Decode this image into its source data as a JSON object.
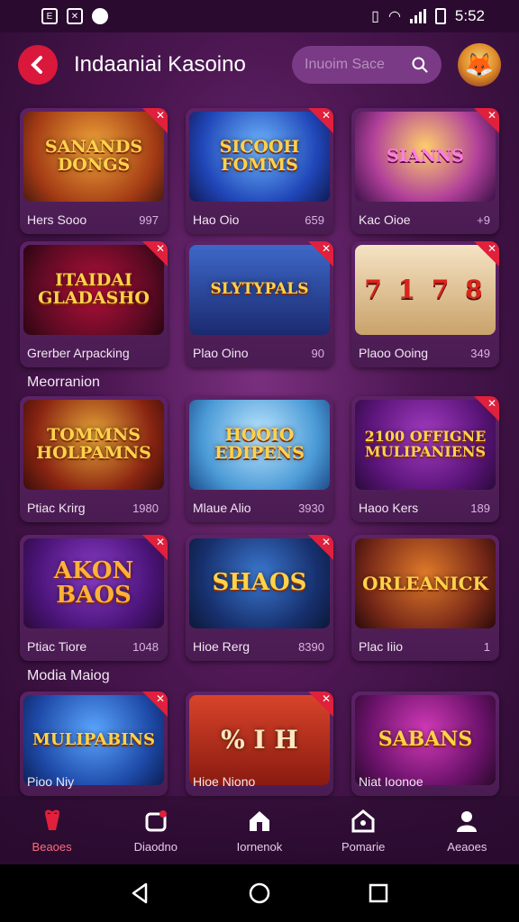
{
  "status_bar": {
    "time": "5:52"
  },
  "header": {
    "title": "Indaaniai Kasoino",
    "search_placeholder": "Inuoim Sace"
  },
  "sections": [
    {
      "label": "Meorranion"
    },
    {
      "label": "Modia Maiog"
    }
  ],
  "cards": [
    {
      "art": "SANANDS DONGS",
      "caption": "Hers Sooo",
      "meta": "997"
    },
    {
      "art": "SICOOH FOMMS",
      "caption": "Hao Oio",
      "meta": "659"
    },
    {
      "art": "SIANNS",
      "caption": "Kac Oioe",
      "meta": "+9"
    },
    {
      "art": "ITAIDAI GLADASHO",
      "caption": "Grerber Arpacking",
      "meta": ""
    },
    {
      "art": "SLYTYPALS",
      "caption": "Plao Oino",
      "meta": "90"
    },
    {
      "art": "7 1 7 8",
      "caption": "Plaoo Ooing",
      "meta": "349"
    },
    {
      "art": "TOMMNS HOLPAMNS",
      "caption": "Ptiac Krirg",
      "meta": "1980"
    },
    {
      "art": "HOOIO EDIPENS",
      "caption": "Mlaue Alio",
      "meta": "3930"
    },
    {
      "art": "2100 OFFIGNE MULIPANIENS",
      "caption": "Haoo Kers",
      "meta": "189"
    },
    {
      "art": "AKON BAOS",
      "caption": "Ptiac Tiore",
      "meta": "1048"
    },
    {
      "art": "SHAOS",
      "caption": "Hioe Rerg",
      "meta": "8390"
    },
    {
      "art": "ORLEANICK",
      "caption": "Plac Iiio",
      "meta": "1"
    },
    {
      "art": "MULIPABINS",
      "caption": "Pioo Niy",
      "meta": ""
    },
    {
      "art": "% I H",
      "caption": "Hioe Niono",
      "meta": ""
    },
    {
      "art": "SABANS",
      "caption": "Niat Ioonoe",
      "meta": ""
    }
  ],
  "bottom_nav": [
    {
      "label": "Beaoes",
      "icon": "gift-icon"
    },
    {
      "label": "Diaodno",
      "icon": "slot-icon"
    },
    {
      "label": "Iornenok",
      "icon": "home-icon"
    },
    {
      "label": "Pomarie",
      "icon": "house-icon"
    },
    {
      "label": "Aeaoes",
      "icon": "profile-icon"
    }
  ],
  "colors": {
    "accent": "#e0203c",
    "background": "#4a1650",
    "card": "#5d2266"
  }
}
